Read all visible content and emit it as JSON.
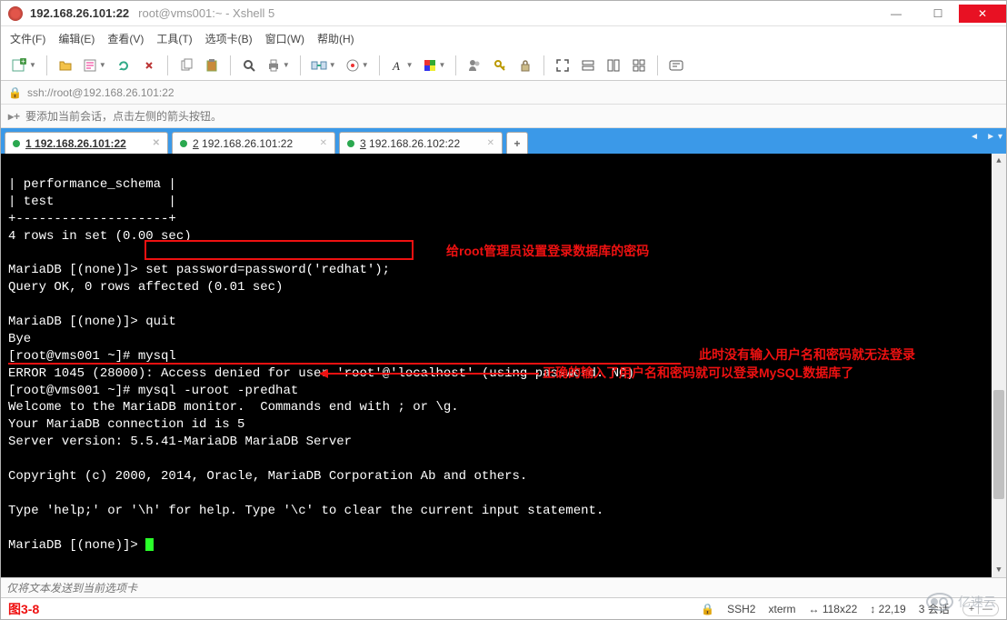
{
  "title": {
    "ip": "192.168.26.101:22",
    "suffix": "root@vms001:~ - Xshell 5"
  },
  "menu": {
    "file": "文件(F)",
    "edit": "编辑(E)",
    "view": "查看(V)",
    "tools": "工具(T)",
    "tabs": "选项卡(B)",
    "window": "窗口(W)",
    "help": "帮助(H)"
  },
  "address": "ssh://root@192.168.26.101:22",
  "hint": "要添加当前会话，点击左侧的箭头按钮。",
  "tabs": [
    {
      "num": "1",
      "label": "192.168.26.101:22",
      "active": true
    },
    {
      "num": "2",
      "label": "192.168.26.101:22",
      "active": false
    },
    {
      "num": "3",
      "label": "192.168.26.102:22",
      "active": false
    }
  ],
  "terminal": {
    "l1": "| performance_schema |",
    "l2": "| test               |",
    "l3": "+--------------------+",
    "l4": "4 rows in set (0.00 sec)",
    "l5": "",
    "l6a": "MariaDB [(none)]> ",
    "l6b": "set password=password('redhat');",
    "l7": "Query OK, 0 rows affected (0.01 sec)",
    "l8": "",
    "l9": "MariaDB [(none)]> quit",
    "l10": "Bye",
    "l11": "[root@vms001 ~]# mysql",
    "l12": "ERROR 1045 (28000): Access denied for user 'root'@'localhost' (using password: NO)",
    "l13": "[root@vms001 ~]# mysql -uroot -predhat",
    "l14": "Welcome to the MariaDB monitor.  Commands end with ; or \\g.",
    "l15": "Your MariaDB connection id is 5",
    "l16": "Server version: 5.5.41-MariaDB MariaDB Server",
    "l17": "",
    "l18": "Copyright (c) 2000, 2014, Oracle, MariaDB Corporation Ab and others.",
    "l19": "",
    "l20": "Type 'help;' or '\\h' for help. Type '\\c' to clear the current input statement.",
    "l21": "",
    "l22": "MariaDB [(none)]> "
  },
  "annotations": {
    "a1": "给root管理员设置登录数据库的密码",
    "a2": "此时没有输入用户名和密码就无法登录",
    "a3": "正确的输入了用户名和密码就可以登录MySQL数据库了"
  },
  "input_placeholder": "仅将文本发送到当前选项卡",
  "figure_label": "图3-8",
  "status": {
    "ssh": "SSH2",
    "term": "xterm",
    "size": "118x22",
    "cursor": "22,19",
    "sessions_label": "3 会话",
    "plus": "+",
    "x": "x",
    "updown": "↕",
    "sizeicon": "↔",
    "lock": "🔒"
  },
  "watermark_text": "亿速云"
}
